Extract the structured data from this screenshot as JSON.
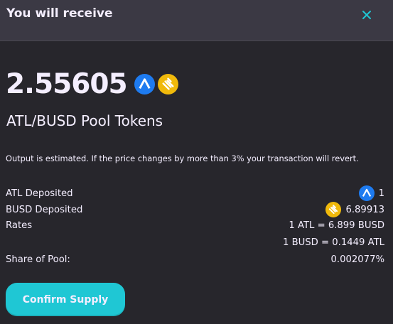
{
  "header": {
    "title": "You will receive"
  },
  "receive": {
    "amount": "2.55605",
    "pool_name": "ATL/BUSD Pool Tokens"
  },
  "notice": "Output is estimated. If the price changes by more than 3% your transaction will revert.",
  "details": {
    "atl_label": "ATL Deposited",
    "atl_value": "1",
    "busd_label": "BUSD Deposited",
    "busd_value": "6.89913",
    "rates_label": "Rates",
    "rate1": "1 ATL = 6.899 BUSD",
    "rate2": "1 BUSD = 0.1449 ATL",
    "share_label": "Share of Pool:",
    "share_value": "0.002077%"
  },
  "actions": {
    "confirm_label": "Confirm Supply"
  },
  "icons": {
    "close": "close-icon",
    "atl": "atl-token-icon",
    "busd": "busd-token-icon"
  },
  "colors": {
    "accent": "#1fc7d4",
    "atl": "#1e7bf0",
    "busd": "#f0b90b"
  }
}
